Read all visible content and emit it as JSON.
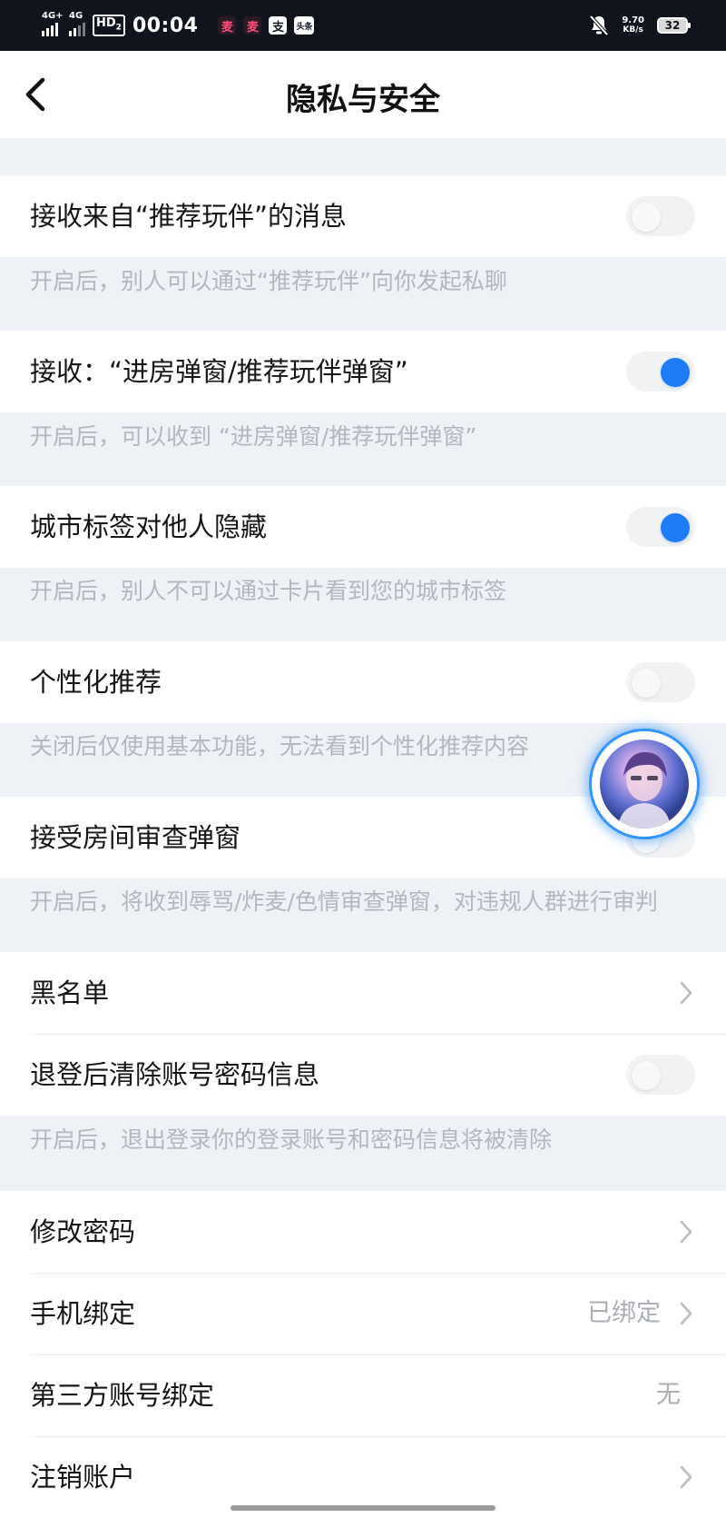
{
  "status_bar": {
    "signal1": "4G+",
    "signal2": "4G",
    "hd": "HD",
    "hd_sub": "2",
    "time": "00:04",
    "app_icon_1": "麦",
    "app_icon_2": "麦",
    "app_icon_3": "支",
    "app_icon_4": "头条",
    "net_speed_value": "9.70",
    "net_speed_unit": "KB/s",
    "battery": "32"
  },
  "header": {
    "title": "隐私与安全",
    "back_icon": "chevron-left-icon"
  },
  "settings": {
    "recommend_msg": {
      "label": "接收来自“推荐玩伴”的消息",
      "desc": "开启后，别人可以通过“推荐玩伴”向你发起私聊",
      "enabled": false
    },
    "popup": {
      "label": "接收：“进房弹窗/推荐玩伴弹窗”",
      "desc": "开启后，可以收到 “进房弹窗/推荐玩伴弹窗”",
      "enabled": true
    },
    "city_tag": {
      "label": "城市标签对他人隐藏",
      "desc": "开启后，别人不可以通过卡片看到您的城市标签",
      "enabled": true
    },
    "personalized": {
      "label": "个性化推荐",
      "desc": "关闭后仅使用基本功能，无法看到个性化推荐内容",
      "enabled": false
    },
    "room_review": {
      "label": "接受房间审查弹窗",
      "desc": "开启后，将收到辱骂/炸麦/色情审查弹窗，对违规人群进行审判",
      "enabled": false
    },
    "blacklist": {
      "label": "黑名单"
    },
    "clear_account": {
      "label": "退登后清除账号密码信息",
      "desc": "开启后，退出登录你的登录账号和密码信息将被清除",
      "enabled": false
    },
    "change_password": {
      "label": "修改密码"
    },
    "phone_binding": {
      "label": "手机绑定",
      "value": "已绑定"
    },
    "third_party": {
      "label": "第三方账号绑定",
      "value": "无"
    },
    "delete_account": {
      "label": "注销账户"
    }
  },
  "colors": {
    "accent": "#1e7cf6",
    "page_bg": "#eef1f5",
    "desc_text": "#b3b7be"
  }
}
